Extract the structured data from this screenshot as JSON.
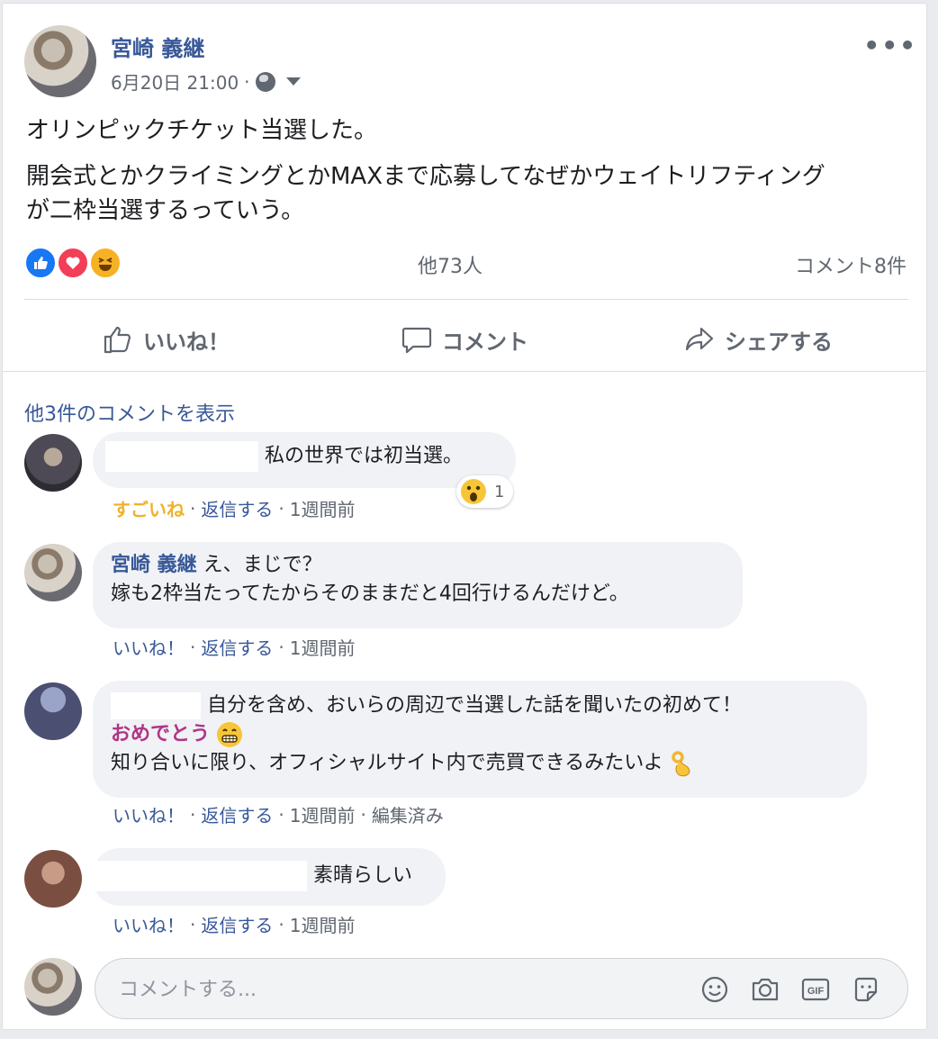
{
  "post": {
    "author": "宮崎 義継",
    "timestamp": "6月20日 21:00",
    "meta_sep": "·",
    "more_label": "•••",
    "text_line1": "オリンピックチケット当選した。",
    "text_line2a": "開会式とかクライミングとかMAXまで応募してなぜかウェイトリフティング",
    "text_line2b": "が二枠当選するっていう。",
    "reactions_text": "他73人",
    "comment_count": "コメント8件",
    "reaction_icons": [
      "like-icon",
      "love-icon",
      "haha-icon"
    ]
  },
  "actions": {
    "like": "いいね！",
    "comment": "コメント",
    "share": "シェアする"
  },
  "more_comments": "他3件のコメントを表示",
  "comments": [
    {
      "text": "私の世界では初当選。",
      "reaction_count": "1",
      "like_label": "すごいね",
      "reply_label": "返信する",
      "time": "1週間前"
    },
    {
      "author": "宮崎 義継",
      "text_line1": "え、まじで？",
      "text_line2": "嫁も2枠当たってたからそのままだと4回行けるんだけど。",
      "like_label": "いいね！",
      "reply_label": "返信する",
      "time": "1週間前"
    },
    {
      "text_line1": "自分を含め、おいらの周辺で当選した話を聞いたの初めて！",
      "text_line2": "おめでとう",
      "text_line3": "知り合いに限り、オフィシャルサイト内で売買できるみたいよ",
      "like_label": "いいね！",
      "reply_label": "返信する",
      "time": "1週間前",
      "edited": "編集済み"
    },
    {
      "text": "素晴らしい",
      "like_label": "いいね！",
      "reply_label": "返信する",
      "time": "1週間前"
    }
  ],
  "composer": {
    "placeholder": "コメントする..."
  },
  "sep": "·",
  "colors": {
    "link_blue": "#385898",
    "fb_blue": "#1877f2",
    "wow_gold": "#f0b129",
    "bubble_bg": "#f0f2f5"
  }
}
